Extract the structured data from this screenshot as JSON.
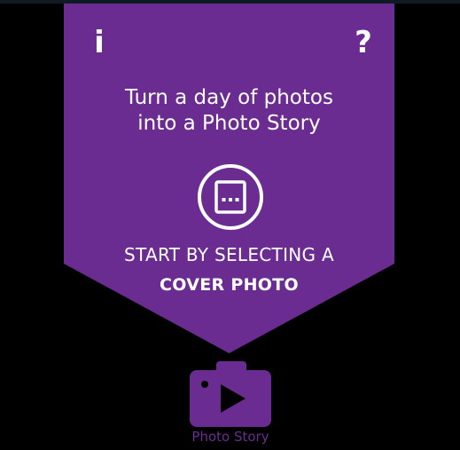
{
  "colors": {
    "background": "#000000",
    "accent": "#6a2c91",
    "text": "#ffffff"
  },
  "header": {
    "info_label": "i",
    "help_label": "?"
  },
  "banner": {
    "tagline_line1": "Turn a day of photos",
    "tagline_line2": "into a Photo Story",
    "select_icon": "photo-picker-icon",
    "cta_line1": "START BY SELECTING A",
    "cta_line2": "COVER PHOTO"
  },
  "app": {
    "icon": "camera-play-icon",
    "label": "Photo Story"
  }
}
